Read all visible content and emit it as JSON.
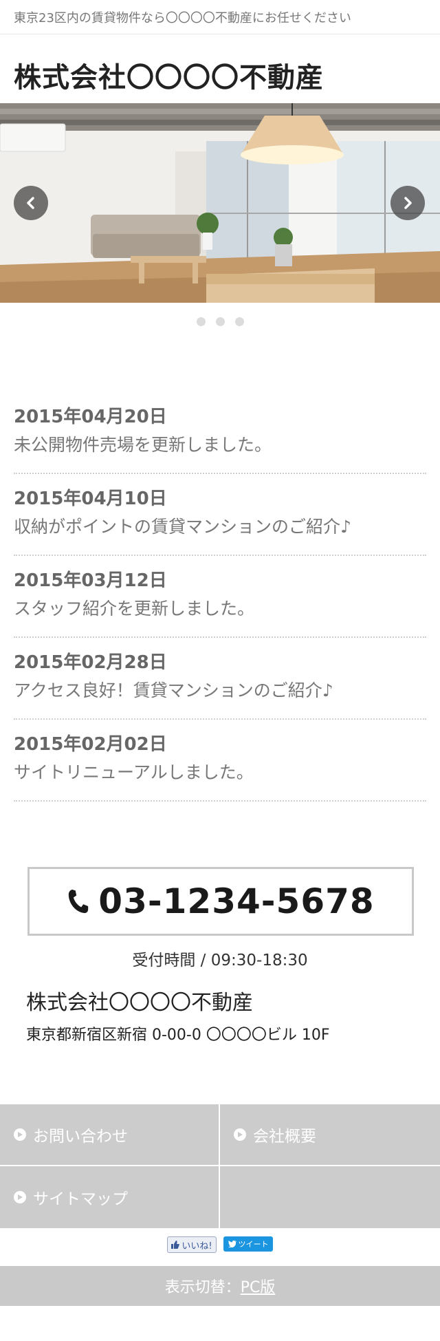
{
  "header": {
    "tagline": "東京23区内の賃貸物件なら〇〇〇〇不動産にお任せください",
    "site_title": "株式会社〇〇〇〇不動産"
  },
  "slider": {
    "slide_count": 3,
    "active_index": 0
  },
  "news": [
    {
      "date": "2015年04月20日",
      "text": "未公開物件売場を更新しました。"
    },
    {
      "date": "2015年04月10日",
      "text": "収納がポイントの賃貸マンションのご紹介♪"
    },
    {
      "date": "2015年03月12日",
      "text": "スタッフ紹介を更新しました。"
    },
    {
      "date": "2015年02月28日",
      "text": "アクセス良好！賃貸マンションのご紹介♪"
    },
    {
      "date": "2015年02月02日",
      "text": "サイトリニューアルしました。"
    }
  ],
  "contact": {
    "phone": "03-1234-5678",
    "hours": "受付時間 / 09:30-18:30",
    "company_name": "株式会社〇〇〇〇不動産",
    "address": "東京都新宿区新宿 0-00-0 〇〇〇〇ビル 10F"
  },
  "footer_nav": {
    "items": [
      {
        "label": "お問い合わせ"
      },
      {
        "label": "会社概要"
      },
      {
        "label": "サイトマップ"
      },
      {
        "label": ""
      }
    ]
  },
  "social": {
    "like_label": "いいね!",
    "tweet_label": "ツイート"
  },
  "switcher": {
    "prefix": "表示切替：",
    "pc_label": "PC版"
  },
  "colors": {
    "footer_bg": "#cccccc",
    "tweet_blue": "#1b95e0",
    "like_blue": "#3b5998"
  }
}
